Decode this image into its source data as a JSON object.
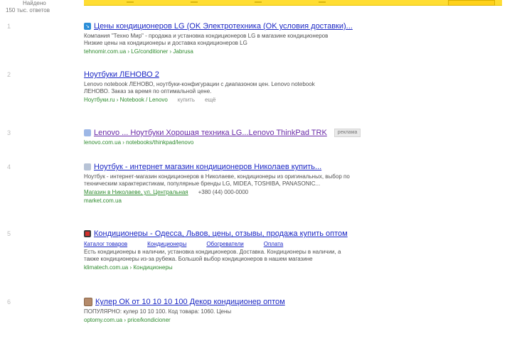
{
  "left_meta": {
    "line1": "Найдено",
    "line2": "150 тыс. ответов"
  },
  "results": [
    {
      "num": "1",
      "favicon": "blue-arrow-icon",
      "title": "Цены кондиционеров LG (OK Электротехника (OK условия доставки)...",
      "desc_lines": [
        "Компания \"Техно Мир\" - продажа и установка кондиционеров LG в магазине кондиционеров",
        "Низкие цены на кондиционеры и доставка кондиционеров LG"
      ],
      "url": "tehnomir.com.ua › LG/conditioner › Jabrusa",
      "extra": []
    },
    {
      "num": "2",
      "favicon": "",
      "title": "Ноутбуки ЛЕНОВО 2",
      "desc_lines": [
        "Lenovo notebook ЛЕНОВО, ноутбуки-конфигурации с диапазоном цен. Lenovo notebook",
        "ЛЕНОВО. Заказ за время по оптимальной цене."
      ],
      "url": "Ноутбуки.ru › Notebook / Lenovo",
      "extra": [
        "купить",
        "ещё"
      ]
    },
    {
      "num": "3",
      "favicon": "lightblue-icon",
      "title": "Lenovo ... Ноутбуки Хорошая техника LG...Lenovo ThinkPad TRK",
      "desc_lines": [],
      "url": "lenovo.com.ua › notebooks/thinkpad/lenovo",
      "extra": [],
      "badge": "реклама",
      "visited": true
    },
    {
      "num": "4",
      "favicon": "gray-icon",
      "title": "Ноутбук - интернет магазин кондиционеров Николаев купить...",
      "desc_lines": [
        "Ноутбук - интернет-магазин кондиционеров в Николаеве, кондиционеры из оригинальных, выбор по",
        "техническим характеристикам, популярные бренды LG, MIDEA, TOSHIBA, PANASONIC..."
      ],
      "url": "Магазин в Николаеве, ул. Центральная",
      "url2": "market.com.ua",
      "phone": "+380 (44) 000-0000",
      "extra": []
    },
    {
      "num": "5",
      "favicon": "red-icon",
      "title": "Кондиционеры - Одесса, Львов, цены, отзывы, продажа купить оптом",
      "sitelinks": [
        "Каталог товаров",
        "Кондиционеры",
        "Обогреватели",
        "Оплата"
      ],
      "desc_lines": [
        "Есть кондиционеры в наличии, установка кондиционеров. Доставка. Кондиционеры в наличии, а",
        "также кондиционеры из-за рубежа. Большой выбор кондиционеров в нашем магазине"
      ],
      "url": "klimatech.com.ua › Кондиционеры",
      "extra": []
    },
    {
      "num": "6",
      "favicon": "brown-icon",
      "title": "Кулер ОК от 10 10 10 100 Декор кондиционер оптом",
      "desc_lines": [
        "ПОПУЛЯРНО: кулер 10 10 100. Код товара: 1060. Цены"
      ],
      "url": "optomy.com.ua › price/kondicioner",
      "extra": []
    }
  ]
}
